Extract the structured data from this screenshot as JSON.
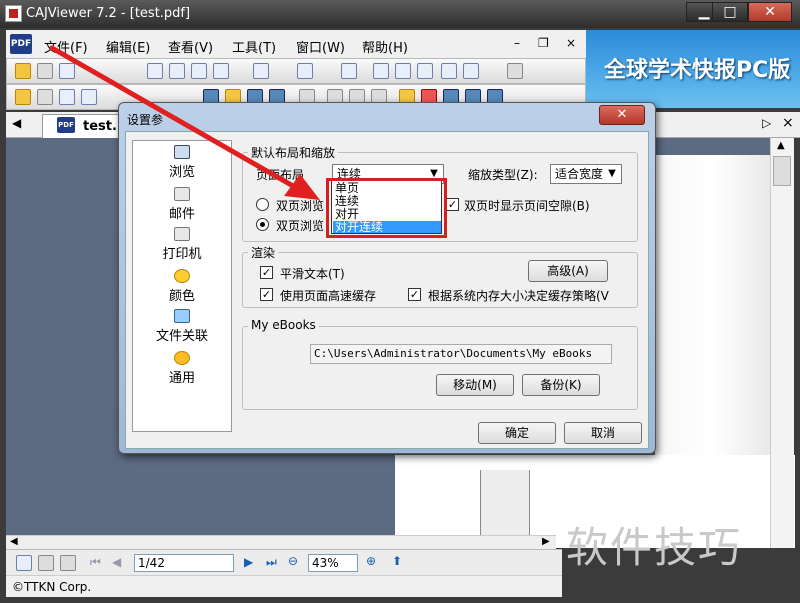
{
  "window": {
    "title": "CAJViewer 7.2 - [test.pdf]",
    "min_icon": "▁",
    "max_icon": "□",
    "close_icon": "✕"
  },
  "menu": {
    "logo": "PDF",
    "items": [
      "文件(F)",
      "编辑(E)",
      "查看(V)",
      "工具(T)",
      "窗口(W)",
      "帮助(H)"
    ]
  },
  "banner": {
    "text": "全球学术快报PC版"
  },
  "tab": {
    "label": "test.pdf",
    "nav_left": "◀",
    "nav_right": "▷",
    "close": "×"
  },
  "status": {
    "page": "1/42",
    "zoom": "43%"
  },
  "copyright": "©TTKN Corp.",
  "watermark": "软件技巧",
  "dialog": {
    "title": "设置参",
    "close_icon": "✕",
    "sidebar": [
      "浏览",
      "邮件",
      "打印机",
      "颜色",
      "文件关联",
      "通用"
    ],
    "layout_group": {
      "title": "默认布局和缩放",
      "page_layout_label": "页面布局",
      "page_layout_value": "连续",
      "zoom_type_label": "缩放类型(Z):",
      "zoom_type_value": "适合宽度",
      "radio1": "双页浏览",
      "radio2": "双页浏览",
      "show_gap": "双页时显示页间空隙(B)"
    },
    "dropdown_options": [
      "单页",
      "连续",
      "对开",
      "对开连续"
    ],
    "render_group": {
      "title": "渲染",
      "smooth_text": "平滑文本(T)",
      "advanced": "高级(A)",
      "page_cache": "使用页面高速缓存",
      "cache_by_memory": "根据系统内存大小决定缓存策略(V"
    },
    "ebooks_group": {
      "title": "My eBooks",
      "path": "C:\\Users\\Administrator\\Documents\\My eBooks",
      "move": "移动(M)",
      "backup": "备份(K)"
    },
    "ok": "确定",
    "cancel": "取消"
  }
}
